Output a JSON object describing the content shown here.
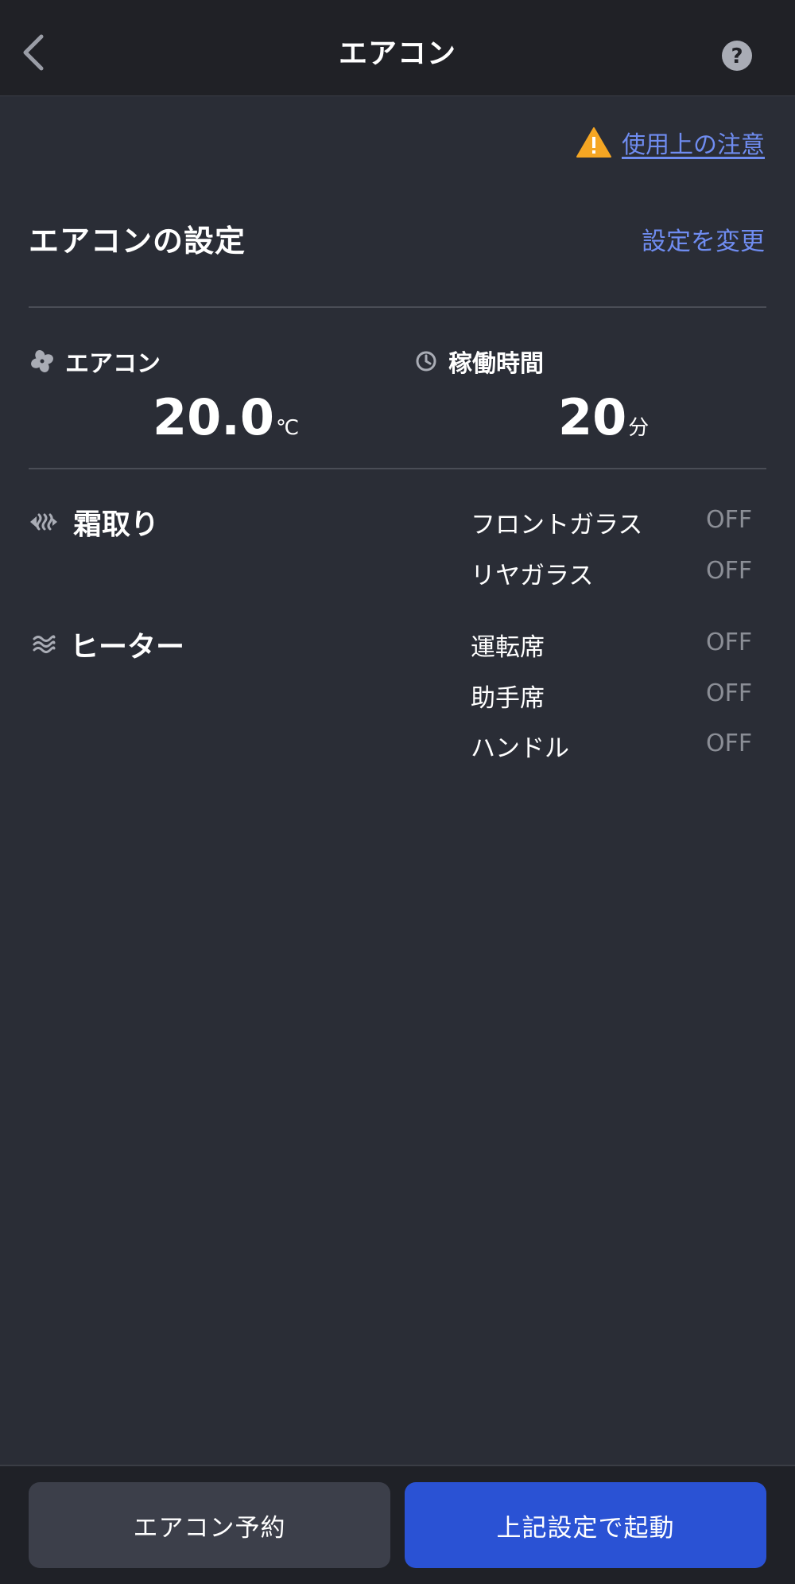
{
  "header": {
    "title": "エアコン",
    "back_icon": "chevron-left-icon",
    "help_icon": "question-circle-icon"
  },
  "notice": {
    "icon": "warning-triangle-icon",
    "link_text": "使用上の注意",
    "icon_color": "#f5a623"
  },
  "settings": {
    "title": "エアコンの設定",
    "change_link": "設定を変更",
    "aircon": {
      "icon": "fan-icon",
      "label": "エアコン",
      "value": "20.0",
      "unit": "℃"
    },
    "runtime": {
      "icon": "clock-icon",
      "label": "稼働時間",
      "value": "20",
      "unit": "分"
    }
  },
  "defrost": {
    "icon": "defrost-icon",
    "title": "霜取り",
    "items": [
      {
        "label": "フロントガラス",
        "value": "OFF"
      },
      {
        "label": "リヤガラス",
        "value": "OFF"
      }
    ]
  },
  "heater": {
    "icon": "heat-waves-icon",
    "title": "ヒーター",
    "items": [
      {
        "label": "運転席",
        "value": "OFF"
      },
      {
        "label": "助手席",
        "value": "OFF"
      },
      {
        "label": "ハンドル",
        "value": "OFF"
      }
    ]
  },
  "actions": {
    "reserve_label": "エアコン予約",
    "start_label": "上記設定で起動",
    "start_color": "#2a52d4"
  },
  "colors": {
    "background": "#2a2d36",
    "header": "#202126",
    "link": "#6f8cf0"
  }
}
